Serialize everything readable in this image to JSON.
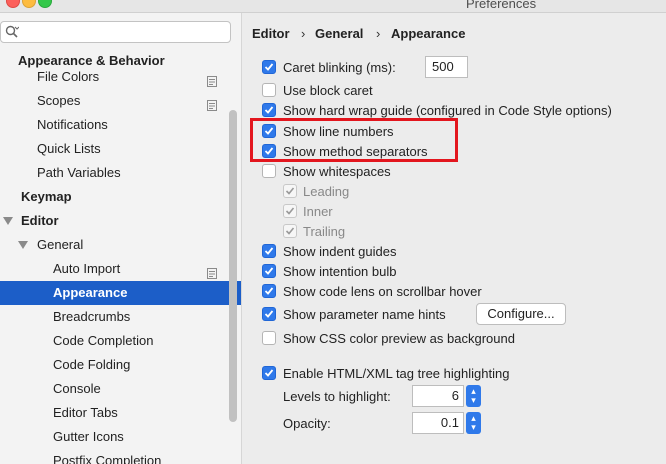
{
  "window": {
    "title": "Preferences"
  },
  "search": {
    "placeholder": ""
  },
  "sidebar": {
    "items": [
      {
        "label": "Appearance & Behavior",
        "bold": true
      },
      {
        "label": "File Colors"
      },
      {
        "label": "Scopes"
      },
      {
        "label": "Notifications"
      },
      {
        "label": "Quick Lists"
      },
      {
        "label": "Path Variables"
      },
      {
        "label": "Keymap",
        "bold": true
      },
      {
        "label": "Editor",
        "bold": true
      },
      {
        "label": "General"
      },
      {
        "label": "Auto Import"
      },
      {
        "label": "Appearance",
        "selected": true
      },
      {
        "label": "Breadcrumbs"
      },
      {
        "label": "Code Completion"
      },
      {
        "label": "Code Folding"
      },
      {
        "label": "Console"
      },
      {
        "label": "Editor Tabs"
      },
      {
        "label": "Gutter Icons"
      },
      {
        "label": "Postfix Completion"
      }
    ]
  },
  "breadcrumb": [
    "Editor",
    "General",
    "Appearance"
  ],
  "settings": {
    "caret_blinking": {
      "label": "Caret blinking (ms):",
      "checked": true,
      "value": "500"
    },
    "block_caret": {
      "label": "Use block caret",
      "checked": false
    },
    "hard_wrap": {
      "label": "Show hard wrap guide (configured in Code Style options)",
      "checked": true
    },
    "line_numbers": {
      "label": "Show line numbers",
      "checked": true
    },
    "method_separators": {
      "label": "Show method separators",
      "checked": true
    },
    "whitespaces": {
      "label": "Show whitespaces",
      "checked": false
    },
    "leading": {
      "label": "Leading",
      "checked": true,
      "disabled": true
    },
    "inner": {
      "label": "Inner",
      "checked": true,
      "disabled": true
    },
    "trailing": {
      "label": "Trailing",
      "checked": true,
      "disabled": true
    },
    "indent_guides": {
      "label": "Show indent guides",
      "checked": true
    },
    "intention_bulb": {
      "label": "Show intention bulb",
      "checked": true
    },
    "code_lens": {
      "label": "Show code lens on scrollbar hover",
      "checked": true
    },
    "param_hints": {
      "label": "Show parameter name hints",
      "checked": true,
      "button": "Configure..."
    },
    "css_color": {
      "label": "Show CSS color preview as background",
      "checked": false
    },
    "tag_tree": {
      "label": "Enable HTML/XML tag tree highlighting",
      "checked": true
    },
    "levels": {
      "label": "Levels to highlight:",
      "value": "6"
    },
    "opacity": {
      "label": "Opacity:",
      "value": "0.1"
    }
  },
  "colors": {
    "accent": "#2f79ea",
    "selection": "#1c5ec8",
    "annotation": "#e3161e"
  }
}
